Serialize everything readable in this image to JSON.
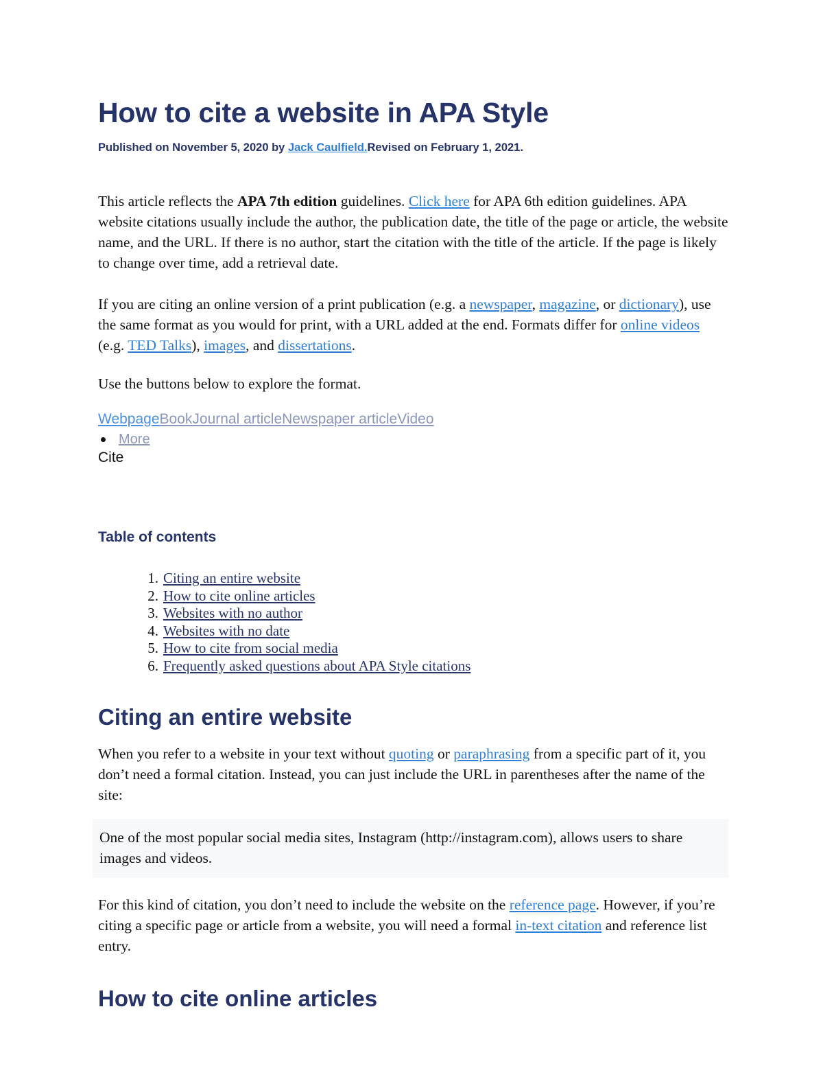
{
  "document": {
    "title": "How to cite a website in APA Style",
    "byline": {
      "prefix": "Published on November 5, 2020 by ",
      "author_link": "Jack Caulfield.",
      "suffix": "Revised on February 1, 2021."
    }
  },
  "intro": {
    "paragraph1": {
      "part1": "This article reflects the ",
      "bold1": "APA 7th edition",
      "part2": " guidelines. ",
      "link1": "Click here",
      "part3": " for APA 6th edition guidelines. APA website citations usually include the author, the publication date, the title of the page or article, the website name, and the URL. If there is no author, start the citation with the title of the article. If the page is likely to change over time, add a retrieval date."
    },
    "paragraph2": {
      "part1": "If you are citing an online version of a print publication (e.g. a ",
      "link_newspaper": "newspaper",
      "part2": ", ",
      "link_magazine": "magazine",
      "part3": ", or ",
      "link_dictionary": "dictionary",
      "part4": "), use the same format as you would for print, with a URL added at the end. Formats differ for ",
      "link_online_videos": "online videos",
      "part5": " (e.g. ",
      "link_ted_talks": "TED Talks",
      "part6": "), ",
      "link_images": "images",
      "part7": ", and ",
      "link_dissertations": "dissertations",
      "part8": "."
    },
    "paragraph3": "Use the buttons below to explore the format."
  },
  "format_tabs": {
    "active": "Webpage",
    "inactive": "BookJournal articleNewspaper articleVideo",
    "more_label": "More",
    "cite_label": "Cite"
  },
  "table_of_contents": {
    "heading": "Table of contents",
    "items": [
      "Citing an entire website",
      "How to cite online articles",
      "Websites with no author",
      "Websites with no date",
      "How to cite from social media",
      "Frequently asked questions about APA Style citations"
    ]
  },
  "section_citing_entire_website": {
    "heading": "Citing an entire website",
    "paragraph1": {
      "part1": "When you refer to a website in your text without ",
      "link_quoting": "quoting",
      "part2": " or ",
      "link_paraphrasing": "paraphrasing",
      "part3": " from a specific part of it, you don’t need a formal citation. Instead, you can just include the URL in parentheses after the name of the site:"
    },
    "example": "One of the most popular social media sites, Instagram (http://instagram.com), allows users to share images and videos.",
    "paragraph2": {
      "part1": "For this kind of citation, you don’t need to include the website on the ",
      "link_reference_page": "reference page",
      "part2": ". However, if you’re citing a specific page or article from a website, you will need a formal ",
      "link_in_text_citation": "in-text citation",
      "part3": " and reference list entry."
    }
  },
  "section_online_articles": {
    "heading": "How to cite online articles"
  },
  "colors": {
    "heading_navy": "#253368",
    "link_blue": "#2f7fd6",
    "tab_active_blue": "#4a90e2",
    "tab_inactive_grayblue": "#8d96bb",
    "body_text": "#131313",
    "example_background": "#f7f8fa",
    "page_background": "#ffffff"
  }
}
